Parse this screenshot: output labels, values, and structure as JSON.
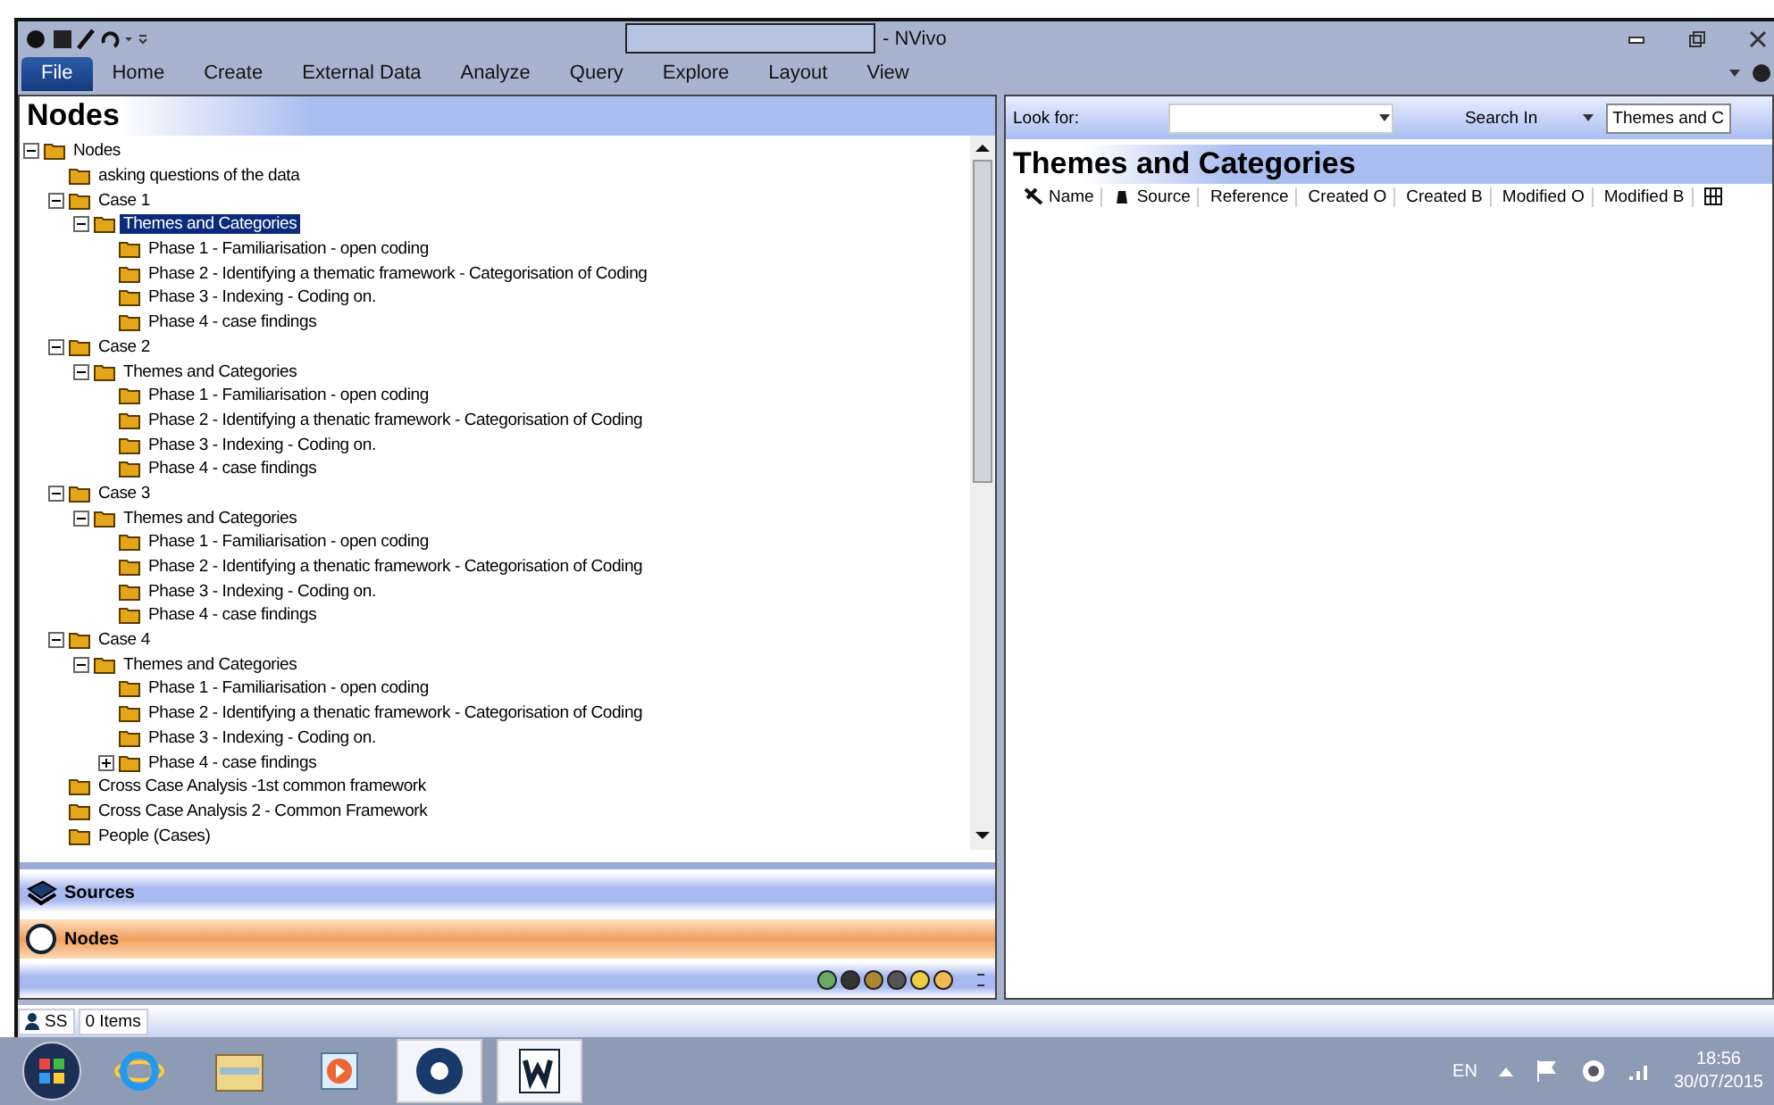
{
  "window": {
    "title": "- NVivo"
  },
  "ribbon_tabs": [
    {
      "label": "File",
      "selected": true
    },
    {
      "label": "Home",
      "selected": false
    },
    {
      "label": "Create",
      "selected": false
    },
    {
      "label": "External Data",
      "selected": false
    },
    {
      "label": "Analyze",
      "selected": false
    },
    {
      "label": "Query",
      "selected": false
    },
    {
      "label": "Explore",
      "selected": false
    },
    {
      "label": "Layout",
      "selected": false
    },
    {
      "label": "View",
      "selected": false
    }
  ],
  "left_pane": {
    "title": "Nodes",
    "tree": [
      {
        "label": "Nodes",
        "expanded": true,
        "selected": false,
        "children": [
          {
            "label": "asking questions of the data",
            "selected": false
          },
          {
            "label": "Case 1",
            "expanded": true,
            "selected": false,
            "children": [
              {
                "label": "Themes and Categories",
                "expanded": true,
                "selected": true,
                "children": [
                  {
                    "label": "Phase 1 - Familiarisation - open coding",
                    "selected": false
                  },
                  {
                    "label": "Phase 2 - Identifying a thematic framework - Categorisation of Coding",
                    "selected": false
                  },
                  {
                    "label": "Phase 3 - Indexing - Coding on.",
                    "selected": false
                  },
                  {
                    "label": "Phase 4 - case findings",
                    "selected": false
                  }
                ]
              }
            ]
          },
          {
            "label": "Case 2",
            "expanded": true,
            "selected": false,
            "children": [
              {
                "label": "Themes and Categories",
                "expanded": true,
                "selected": false,
                "children": [
                  {
                    "label": "Phase 1 - Familiarisation - open coding",
                    "selected": false
                  },
                  {
                    "label": "Phase 2 - Identifying a thenatic framework - Categorisation of Coding",
                    "selected": false
                  },
                  {
                    "label": "Phase 3 - Indexing - Coding on.",
                    "selected": false
                  },
                  {
                    "label": "Phase 4 - case findings",
                    "selected": false
                  }
                ]
              }
            ]
          },
          {
            "label": "Case 3",
            "expanded": true,
            "selected": false,
            "children": [
              {
                "label": "Themes and Categories",
                "expanded": true,
                "selected": false,
                "children": [
                  {
                    "label": "Phase 1 - Familiarisation - open coding",
                    "selected": false
                  },
                  {
                    "label": "Phase 2 - Identifying a thenatic framework - Categorisation of Coding",
                    "selected": false
                  },
                  {
                    "label": "Phase 3 - Indexing - Coding on.",
                    "selected": false
                  },
                  {
                    "label": "Phase 4 - case findings",
                    "selected": false
                  }
                ]
              }
            ]
          },
          {
            "label": "Case 4",
            "expanded": true,
            "selected": false,
            "children": [
              {
                "label": "Themes and Categories",
                "expanded": true,
                "selected": false,
                "children": [
                  {
                    "label": "Phase 1 - Familiarisation - open coding",
                    "selected": false
                  },
                  {
                    "label": "Phase 2 - Identifying a thenatic framework - Categorisation of Coding",
                    "selected": false
                  },
                  {
                    "label": "Phase 3 - Indexing - Coding on.",
                    "selected": false
                  },
                  {
                    "label": "Phase 4 - case findings",
                    "expanded": false,
                    "selected": false
                  }
                ]
              }
            ]
          },
          {
            "label": "Cross Case Analysis -1st  common framework",
            "selected": false
          },
          {
            "label": "Cross Case Analysis 2 - Common Framework",
            "selected": false
          },
          {
            "label": "People (Cases)",
            "selected": false
          }
        ]
      }
    ],
    "navigation": [
      {
        "label": "Sources",
        "kind": "sources",
        "selected": false
      },
      {
        "label": "Nodes",
        "kind": "nodes",
        "selected": true
      }
    ]
  },
  "right_pane": {
    "look_for_label": "Look for:",
    "search_in_label": "Search In",
    "search_scope": "Themes and C",
    "title": "Themes and Categories",
    "columns": [
      "Name",
      "Source",
      "Reference",
      "Created O",
      "Created B",
      "Modified O",
      "Modified B"
    ]
  },
  "status_bar": {
    "user": "SS",
    "items": "0 Items"
  },
  "taskbar": {
    "language": "EN",
    "time": "18:56",
    "date": "30/07/2015"
  }
}
